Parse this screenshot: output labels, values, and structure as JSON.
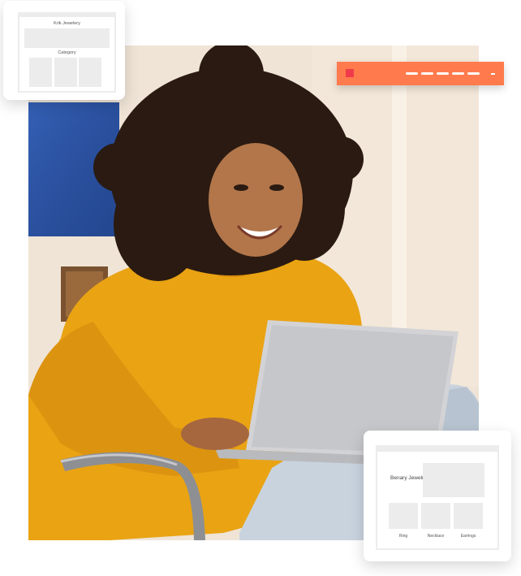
{
  "card_top": {
    "store_title": "Krik Jewelery",
    "section_label": "Category"
  },
  "card_bottom": {
    "brand_title": "Benary Jewelry",
    "categories": [
      "Ring",
      "Necklace",
      "Earrings"
    ]
  },
  "colors": {
    "accent_orange": "#ff7b4d",
    "accent_red": "#f03a4a",
    "sweater_yellow": "#e9a313",
    "placeholder_gray": "#ececec"
  }
}
